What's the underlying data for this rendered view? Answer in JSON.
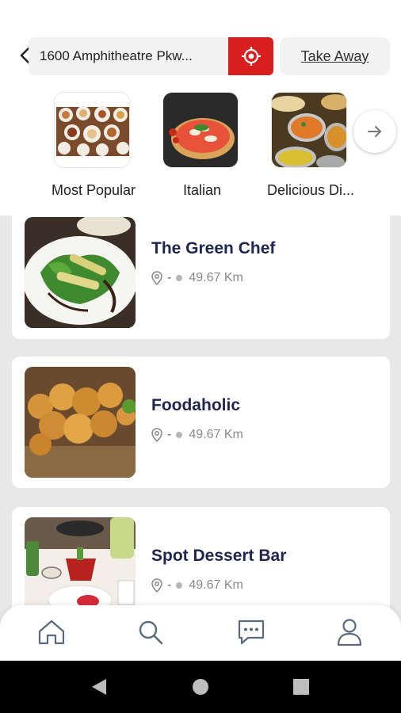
{
  "header": {
    "address": "1600 Amphitheatre Pkw...",
    "take_away_label": "Take Away"
  },
  "categories": [
    {
      "label": "Most Popular",
      "icon": "food-spread-image"
    },
    {
      "label": "Italian",
      "icon": "pizza-image"
    },
    {
      "label": "Delicious Di...",
      "icon": "curry-dishes-image"
    }
  ],
  "restaurants": [
    {
      "name": "The Green Chef",
      "separator": "-",
      "distance": "49.67 Km",
      "image": "salad-plate-image"
    },
    {
      "name": "Foodaholic",
      "separator": "-",
      "distance": "49.67 Km",
      "image": "fried-chicken-image"
    },
    {
      "name": "Spot Dessert Bar",
      "separator": "-",
      "distance": "49.67 Km",
      "image": "dessert-table-image"
    }
  ],
  "bottom_nav": [
    {
      "icon": "home-icon"
    },
    {
      "icon": "search-icon"
    },
    {
      "icon": "chat-icon"
    },
    {
      "icon": "profile-icon"
    }
  ],
  "colors": {
    "accent": "#d81f1f",
    "title": "#1e2552",
    "list_background": "#e8e8e8"
  }
}
